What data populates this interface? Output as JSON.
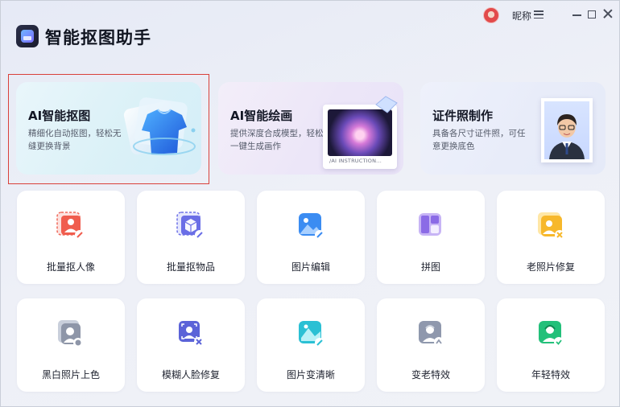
{
  "app": {
    "title": "智能抠图助手"
  },
  "user": {
    "nickname": "昵称"
  },
  "features": [
    {
      "title": "AI智能抠图",
      "desc": "精细化自动抠图，轻松无缝更换背景",
      "icon": "tshirt-icon"
    },
    {
      "title": "AI智能绘画",
      "desc": "提供深度合成模型，轻松一键生成画作",
      "icon": "flower-artwork-icon",
      "caption": "/AI INSTRUCTION..."
    },
    {
      "title": "证件照制作",
      "desc": "具备各尺寸证件照，可任意更换底色",
      "icon": "id-portrait-icon"
    }
  ],
  "tools": [
    {
      "label": "批量抠人像",
      "icon": "batch-portrait-icon"
    },
    {
      "label": "批量抠物品",
      "icon": "batch-object-icon"
    },
    {
      "label": "图片编辑",
      "icon": "image-edit-icon"
    },
    {
      "label": "拼图",
      "icon": "collage-icon"
    },
    {
      "label": "老照片修复",
      "icon": "old-photo-repair-icon"
    },
    {
      "label": "黑白照片上色",
      "icon": "colorize-photo-icon"
    },
    {
      "label": "模糊人脸修复",
      "icon": "face-repair-icon"
    },
    {
      "label": "图片变清晰",
      "icon": "image-enhance-icon"
    },
    {
      "label": "变老特效",
      "icon": "aging-effect-icon"
    },
    {
      "label": "年轻特效",
      "icon": "youth-effect-icon"
    }
  ],
  "colors": {
    "selection": "#d9403a",
    "accent": "#3c7cf0"
  }
}
